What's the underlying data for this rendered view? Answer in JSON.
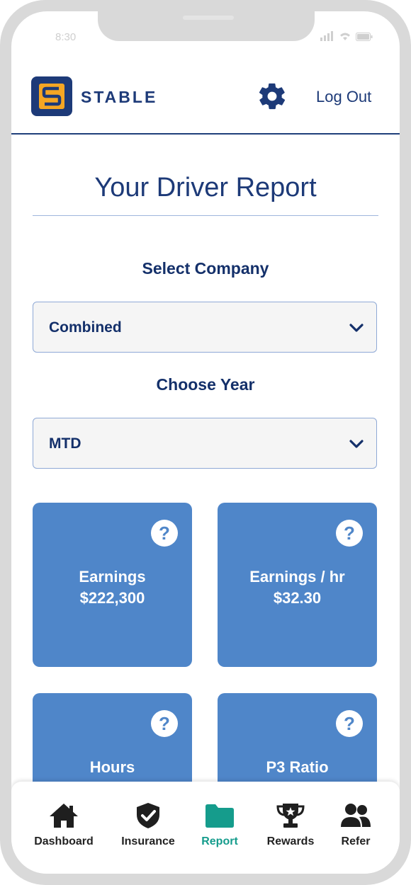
{
  "status": {
    "time": "8:30"
  },
  "header": {
    "logo_letter": "S",
    "brand": "STABLE",
    "logout_label": "Log Out"
  },
  "page": {
    "title": "Your Driver Report"
  },
  "company": {
    "label": "Select Company",
    "selected": "Combined"
  },
  "year": {
    "label": "Choose Year",
    "selected": "MTD"
  },
  "cards": [
    {
      "label": "Earnings",
      "value": "$222,300"
    },
    {
      "label": "Earnings / hr",
      "value": "$32.30"
    },
    {
      "label": "Hours",
      "value": ""
    },
    {
      "label": "P3 Ratio",
      "value": ""
    }
  ],
  "help_glyph": "?",
  "nav": {
    "items": [
      {
        "label": "Dashboard",
        "icon": "home-icon"
      },
      {
        "label": "Insurance",
        "icon": "shield-check-icon"
      },
      {
        "label": "Report",
        "icon": "folder-icon",
        "active": true
      },
      {
        "label": "Rewards",
        "icon": "trophy-icon"
      },
      {
        "label": "Refer",
        "icon": "users-icon"
      }
    ]
  },
  "colors": {
    "brand_navy": "#1d3a78",
    "logo_orange": "#f5a623",
    "card_blue": "#4f86c9",
    "active_teal": "#159c8c"
  }
}
